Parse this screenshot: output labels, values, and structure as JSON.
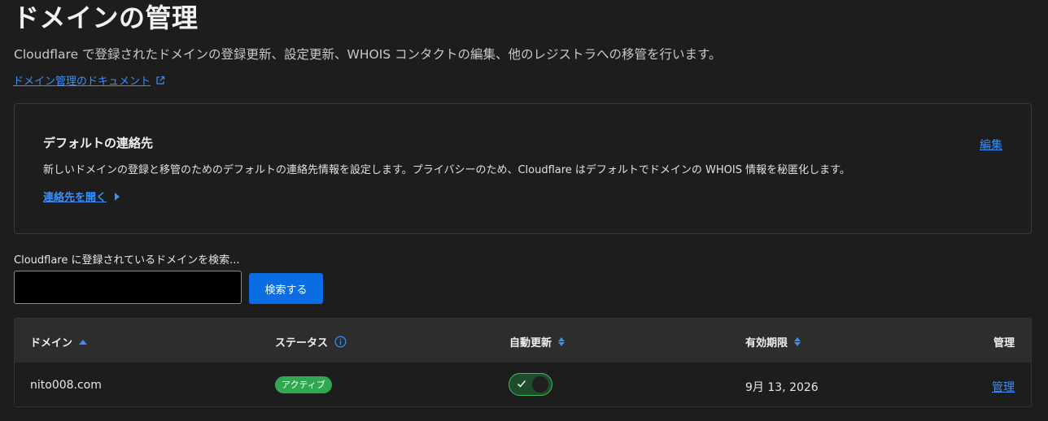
{
  "page": {
    "title": "ドメインの管理",
    "subtitle": "Cloudflare で登録されたドメインの登録更新、設定更新、WHOIS コンタクトの編集、他のレジストラへの移管を行います。",
    "doc_link": "ドメイン管理のドキュメント"
  },
  "contact_card": {
    "title": "デフォルトの連絡先",
    "description": "新しいドメインの登録と移管のためのデフォルトの連絡先情報を設定します。プライバシーのため、Cloudflare はデフォルトでドメインの WHOIS 情報を秘匿化します。",
    "open_link": "連絡先を開く",
    "edit_link": "編集"
  },
  "search": {
    "label": "Cloudflare に登録されているドメインを検索...",
    "value": "",
    "button": "検索する"
  },
  "table": {
    "headers": {
      "domain": "ドメイン",
      "status": "ステータス",
      "auto_renew": "自動更新",
      "expiry": "有効期限",
      "manage": "管理"
    },
    "rows": [
      {
        "domain": "nito008.com",
        "status": "アクティブ",
        "auto_renew": true,
        "expiry": "9月 13, 2026",
        "manage": "管理"
      }
    ]
  },
  "colors": {
    "accent": "#3e8ef7",
    "button": "#0a6de3",
    "active_badge": "#2fa84f",
    "background": "#1d1d1d"
  }
}
